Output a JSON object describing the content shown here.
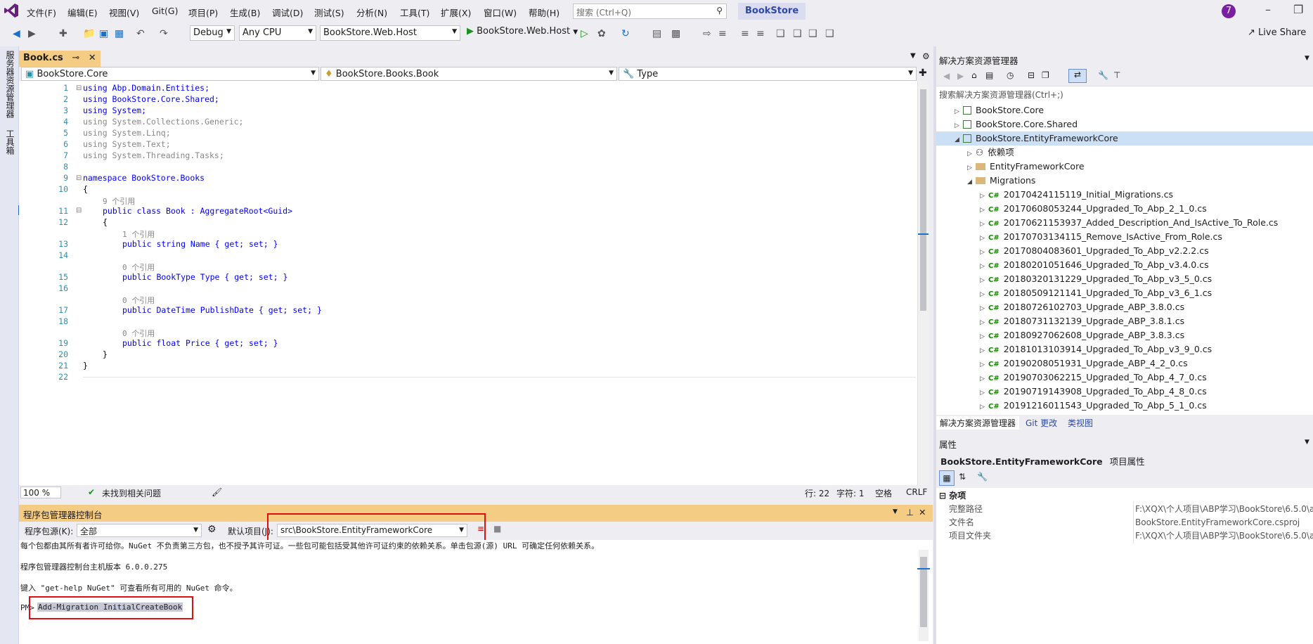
{
  "menu": [
    "文件(F)",
    "编辑(E)",
    "视图(V)",
    "Git(G)",
    "项目(P)",
    "生成(B)",
    "调试(D)",
    "测试(S)",
    "分析(N)",
    "工具(T)",
    "扩展(X)",
    "窗口(W)",
    "帮助(H)"
  ],
  "search": {
    "placeholder": "搜索 (Ctrl+Q)"
  },
  "app_title": "BookStore",
  "avatar": "7",
  "toolbar": {
    "config": "Debug",
    "platform": "Any CPU",
    "startup": "BookStore.Web.Host",
    "run": "BookStore.Web.Host",
    "live_share": "Live Share"
  },
  "left_tabs": [
    "服务器资源管理器",
    "工具箱"
  ],
  "doc_tab": {
    "label": "Book.cs",
    "pin": "⊸",
    "close": "✕"
  },
  "nav": {
    "project": "BookStore.Core",
    "type": "BookStore.Books.Book",
    "member": "Type"
  },
  "code": {
    "line_numbers": [
      "1",
      "2",
      "3",
      "4",
      "5",
      "6",
      "7",
      "8",
      "9",
      "10",
      "11",
      "12",
      "13",
      "14",
      "15",
      "16",
      "17",
      "18",
      "19",
      "20",
      "21",
      "22"
    ],
    "l1": "using Abp.Domain.Entities;",
    "l2": "using BookStore.Core.Shared;",
    "l3": "using System;",
    "l4": "using System.Collections.Generic;",
    "l5": "using System.Linq;",
    "l6": "using System.Text;",
    "l7": "using System.Threading.Tasks;",
    "l9": "namespace BookStore.Books",
    "l10": "{",
    "ref_class": "9 个引用",
    "l11": "public class Book : AggregateRoot<Guid>",
    "l12": "{",
    "ref1": "1 个引用",
    "l13": "public string Name { get; set; }",
    "ref2": "0 个引用",
    "l15": "public BookType Type { get; set; }",
    "ref3": "0 个引用",
    "l17": "public DateTime PublishDate { get; set; }",
    "ref4": "0 个引用",
    "l19": "public float Price { get; set; }",
    "l20": "}",
    "l21": "}"
  },
  "status": {
    "zoom": "100 %",
    "issues": "未找到相关问题",
    "row": "行: 22",
    "col": "字符: 1",
    "space": "空格",
    "eol": "CRLF"
  },
  "pmc": {
    "title": "程序包管理器控制台",
    "source_label": "程序包源(K):",
    "source_value": "全部",
    "default_project_label": "默认项目(J):",
    "default_project_value": "src\\BookStore.EntityFrameworkCore",
    "line1": "每个包都由其所有者许可给你。NuGet 不负责第三方包，也不授予其许可证。一些包可能包括受其他许可证约束的依赖关系。单击包源(源) URL 可确定任何依赖关系。",
    "line2": "程序包管理器控制台主机版本 6.0.0.275",
    "line3": "键入 \"get-help NuGet\" 可查看所有可用的 NuGet 命令。",
    "prompt": "PM>",
    "command": "Add-Migration InitialCreateBook"
  },
  "solution_explorer": {
    "title": "解决方案资源管理器",
    "search_placeholder": "搜索解决方案资源管理器(Ctrl+;)",
    "items": [
      {
        "label": "BookStore.Core",
        "kind": "project",
        "level": 0,
        "expanded": false
      },
      {
        "label": "BookStore.Core.Shared",
        "kind": "project",
        "level": 0,
        "expanded": false
      },
      {
        "label": "BookStore.EntityFrameworkCore",
        "kind": "project",
        "level": 0,
        "expanded": true
      },
      {
        "label": "依赖项",
        "kind": "deps",
        "level": 1,
        "expanded": false
      },
      {
        "label": "EntityFrameworkCore",
        "kind": "folder",
        "level": 1,
        "expanded": false
      },
      {
        "label": "Migrations",
        "kind": "folder",
        "level": 1,
        "expanded": true
      },
      {
        "label": "20170424115119_Initial_Migrations.cs",
        "kind": "cs",
        "level": 2
      },
      {
        "label": "20170608053244_Upgraded_To_Abp_2_1_0.cs",
        "kind": "cs",
        "level": 2
      },
      {
        "label": "20170621153937_Added_Description_And_IsActive_To_Role.cs",
        "kind": "cs",
        "level": 2
      },
      {
        "label": "20170703134115_Remove_IsActive_From_Role.cs",
        "kind": "cs",
        "level": 2
      },
      {
        "label": "20170804083601_Upgraded_To_Abp_v2.2.2.cs",
        "kind": "cs",
        "level": 2
      },
      {
        "label": "20180201051646_Upgraded_To_Abp_v3.4.0.cs",
        "kind": "cs",
        "level": 2
      },
      {
        "label": "20180320131229_Upgraded_To_Abp_v3_5_0.cs",
        "kind": "cs",
        "level": 2
      },
      {
        "label": "20180509121141_Upgraded_To_Abp_v3_6_1.cs",
        "kind": "cs",
        "level": 2
      },
      {
        "label": "20180726102703_Upgrade_ABP_3.8.0.cs",
        "kind": "cs",
        "level": 2
      },
      {
        "label": "20180731132139_Upgrade_ABP_3.8.1.cs",
        "kind": "cs",
        "level": 2
      },
      {
        "label": "20180927062608_Upgrade_ABP_3.8.3.cs",
        "kind": "cs",
        "level": 2
      },
      {
        "label": "20181013103914_Upgraded_To_Abp_v3_9_0.cs",
        "kind": "cs",
        "level": 2
      },
      {
        "label": "20190208051931_Upgrade_ABP_4_2_0.cs",
        "kind": "cs",
        "level": 2
      },
      {
        "label": "20190703062215_Upgraded_To_Abp_4_7_0.cs",
        "kind": "cs",
        "level": 2
      },
      {
        "label": "20190719143908_Upgraded_To_Abp_4_8_0.cs",
        "kind": "cs",
        "level": 2
      },
      {
        "label": "20191216011543_Upgraded_To_Abp_5_1_0.cs",
        "kind": "cs",
        "level": 2
      }
    ],
    "tabs": [
      "解决方案资源管理器",
      "Git 更改",
      "类视图"
    ]
  },
  "properties": {
    "title": "属性",
    "header_name": "BookStore.EntityFrameworkCore",
    "header_suffix": "项目属性",
    "category": "杂项",
    "rows": [
      {
        "name": "完整路径",
        "value": "F:\\XQX\\个人项目\\ABP学习\\BookStore\\6.5.0\\a"
      },
      {
        "name": "文件名",
        "value": "BookStore.EntityFrameworkCore.csproj"
      },
      {
        "name": "项目文件夹",
        "value": "F:\\XQX\\个人项目\\ABP学习\\BookStore\\6.5.0\\a"
      }
    ]
  },
  "colors": {
    "accent": "#f5cc84",
    "highlight": "#e01010",
    "brand": "#68217a"
  }
}
